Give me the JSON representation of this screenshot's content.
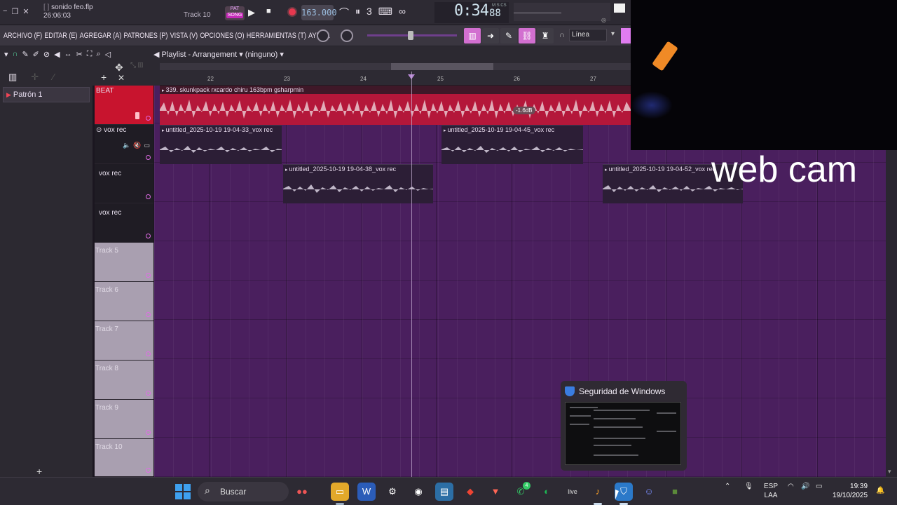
{
  "topbar": {
    "file_name": "sonido feo.flp",
    "elapsed": "26:06:03",
    "track_indicator": "Track 10",
    "pat_label": "PAT",
    "song_label": "SONG",
    "tempo": "163.000",
    "time_main": "0:34",
    "time_ms": "88",
    "time_ms_label": "M:S:CS"
  },
  "menu": [
    "ARCHIVO (F)",
    "EDITAR (E)",
    "AGREGAR (A)",
    "PATRONES (P)",
    "VISTA (V)",
    "OPCIONES (O)",
    "HERRAMIENTAS (T)",
    "AYUDA"
  ],
  "snap": "Línea",
  "playlist": {
    "title": "Playlist - Arrangement",
    "arrangement_selector": "(ninguno)"
  },
  "sidebar": {
    "pattern": "Patrón 1"
  },
  "ruler": [
    "22",
    "23",
    "24",
    "25",
    "26",
    "27"
  ],
  "tracks": [
    {
      "name": "BEAT",
      "style": "beat"
    },
    {
      "name": "vox rec",
      "style": "dark"
    },
    {
      "name": "vox rec",
      "style": "dark"
    },
    {
      "name": "vox rec",
      "style": "dark"
    },
    {
      "name": "Track 5",
      "style": "empty"
    },
    {
      "name": "Track 6",
      "style": "empty"
    },
    {
      "name": "Track 7",
      "style": "empty"
    },
    {
      "name": "Track 8",
      "style": "empty"
    },
    {
      "name": "Track 9",
      "style": "empty"
    },
    {
      "name": "Track 10",
      "style": "empty"
    }
  ],
  "clips": {
    "beat": "339. skunkpack rxcardo chiru 163bpm gsharpmin",
    "beat_db": "-1.6dB",
    "vox1": "untitled_2025-10-19 19-04-33_vox rec",
    "vox2": "untitled_2025-10-19 19-04-45_vox rec",
    "vox3": "untitled_2025-10-19 19-04-38_vox rec",
    "vox4": "untitled_2025-10-19 19-04-52_vox rec"
  },
  "webcam": {
    "label": "web cam"
  },
  "toast": {
    "title": "Seguridad de Windows"
  },
  "taskbar": {
    "search_placeholder": "Buscar",
    "lang_top": "ESP",
    "lang_bottom": "LAA",
    "time": "19:39",
    "date": "19/10/2025",
    "wa_badge": "4"
  },
  "colors": {
    "beat": "#c8142e",
    "grid": "#4a1f5e",
    "accent": "#d26fd0"
  }
}
